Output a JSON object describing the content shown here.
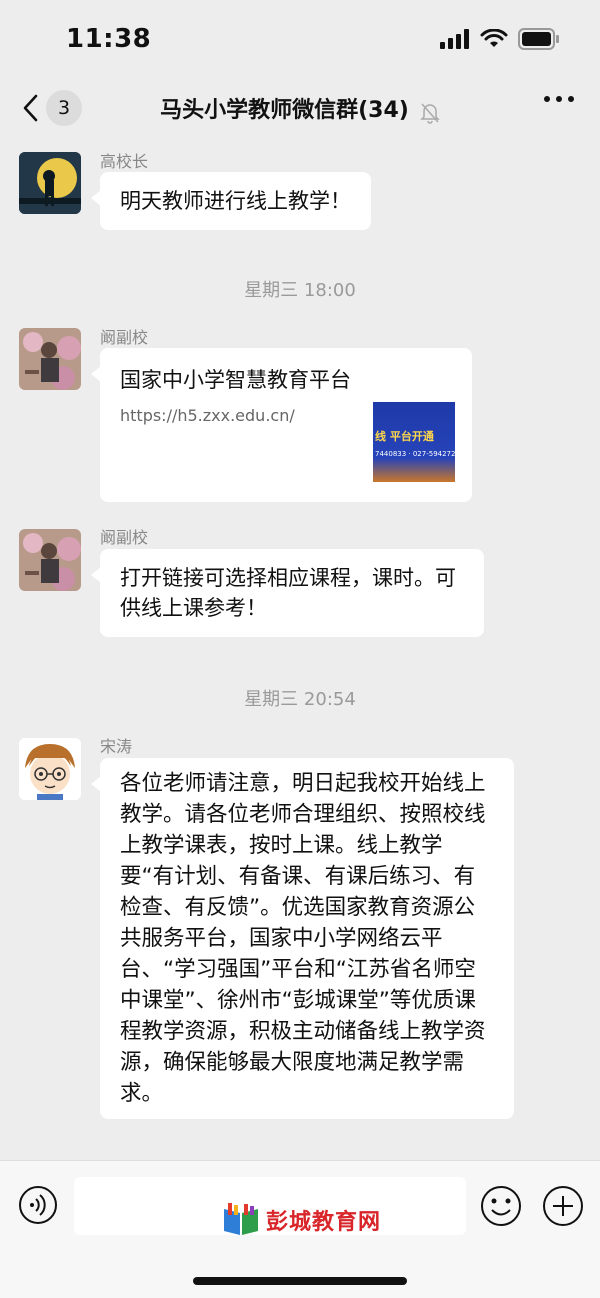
{
  "status_bar": {
    "time": "11:38"
  },
  "nav": {
    "unread_count": "3",
    "title": "马头小学教师微信群(34)"
  },
  "messages": [
    {
      "sender": "高校长",
      "text": "明天教师进行线上教学！"
    },
    {
      "timestamp": "星期三 18:00"
    },
    {
      "sender": "阚副校",
      "link_title": "国家中小学智慧教育平台",
      "link_url": "https://h5.zxx.edu.cn/",
      "thumb_text": "线 平台开通",
      "thumb_sub": "7440833 · 027-59427263"
    },
    {
      "sender": "阚副校",
      "text": "打开链接可选择相应课程，课时。可供线上课参考！"
    },
    {
      "timestamp": "星期三 20:54"
    },
    {
      "sender": "宋涛",
      "text": "各位老师请注意，明日起我校开始线上教学。请各位老师合理组织、按照校线上教学课表，按时上课。线上教学要“有计划、有备课、有课后练习、有检查、有反馈”。优选国家教育资源公共服务平台，国家中小学网络云平台、“学习强国”平台和“江苏省名师空中课堂”、徐州市“彭城课堂”等优质课程教学资源，积极主动储备线上教学资源，确保能够最大限度地满足教学需求。"
    }
  ],
  "watermark": {
    "text": "彭城教育网"
  },
  "icons": [
    "signal-icon",
    "wifi-icon",
    "battery-icon",
    "back-chevron-icon",
    "mute-bell-icon",
    "more-icon",
    "voice-icon",
    "emoji-icon",
    "plus-icon"
  ]
}
